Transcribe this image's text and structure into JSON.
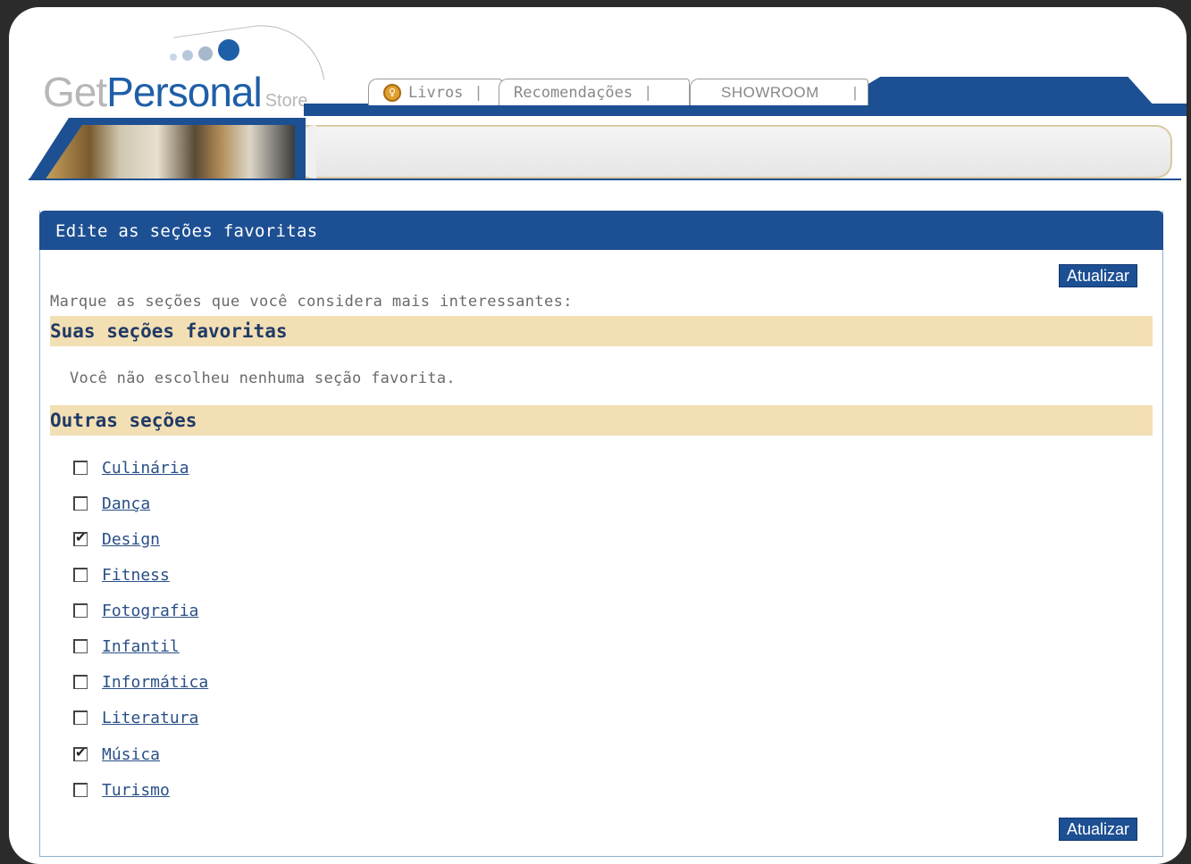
{
  "header": {
    "logo": {
      "get": "Get",
      "personal": "Personal",
      "store": "Store"
    },
    "tabs": [
      {
        "label": "Livros"
      },
      {
        "label": "Recomendações"
      },
      {
        "label": "SHOWROOM"
      }
    ]
  },
  "panel": {
    "title": "Edite as seções favoritas",
    "update_label": "Atualizar",
    "instruction": "Marque as seções que você considera mais interessantes:",
    "favorites": {
      "heading": "Suas seções favoritas",
      "empty_message": "Você não escolheu nenhuma seção favorita."
    },
    "others": {
      "heading": "Outras seções",
      "items": [
        {
          "label": "Culinária",
          "checked": false
        },
        {
          "label": "Dança",
          "checked": false
        },
        {
          "label": "Design",
          "checked": true
        },
        {
          "label": "Fitness",
          "checked": false
        },
        {
          "label": "Fotografia",
          "checked": false
        },
        {
          "label": "Infantil",
          "checked": false
        },
        {
          "label": "Informática",
          "checked": false
        },
        {
          "label": "Literatura",
          "checked": false
        },
        {
          "label": "Música",
          "checked": true
        },
        {
          "label": "Turismo",
          "checked": false
        }
      ]
    }
  },
  "colors": {
    "brand_blue": "#1d4f93",
    "section_bg": "#f3dfb4",
    "link": "#2a4f86"
  }
}
